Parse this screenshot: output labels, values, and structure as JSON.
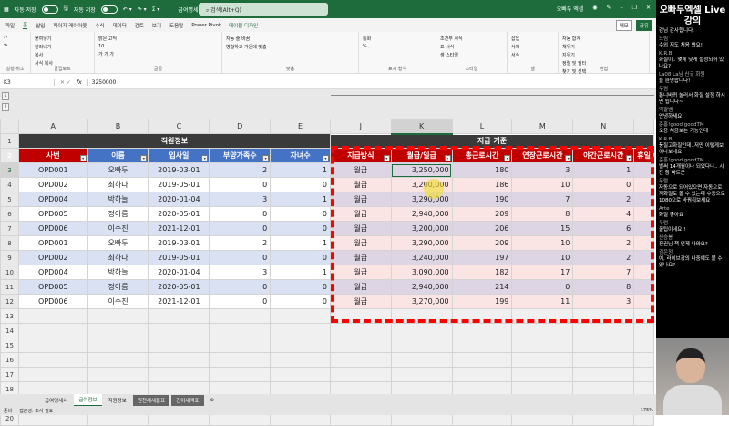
{
  "titlebar": {
    "autosave1": "자동 저장",
    "autosave2": "자동 저장",
    "filename": "급여명세서-예제파일 ▾",
    "search_placeholder": "검색(Alt+Q)",
    "user": "오빠두 엑셀"
  },
  "menu": {
    "items": [
      "파일",
      "홈",
      "삽입",
      "페이지 레이아웃",
      "수식",
      "데이터",
      "검토",
      "보기",
      "도움말",
      "Power Pivot",
      "테이블 디자인"
    ],
    "memo": "메모",
    "share": "공유"
  },
  "ribbon": {
    "groups": [
      {
        "label": "실행 취소",
        "items": [
          "↶",
          "↷"
        ]
      },
      {
        "label": "클립보드",
        "items": [
          "붙여넣기",
          "잘라내기",
          "복사",
          "서식 복사"
        ]
      },
      {
        "label": "글꼴",
        "items": [
          "맑은 고딕",
          "10",
          "가 가 가"
        ]
      },
      {
        "label": "맞춤",
        "items": [
          "자동 줄 바꿈",
          "병합하고 가운데 맞춤"
        ]
      },
      {
        "label": "표시 형식",
        "items": [
          "통화",
          "% ,"
        ]
      },
      {
        "label": "스타일",
        "items": [
          "조건부 서식",
          "표 서식",
          "셀 스타일"
        ]
      },
      {
        "label": "셀",
        "items": [
          "삽입",
          "삭제",
          "서식"
        ]
      },
      {
        "label": "편집",
        "items": [
          "자동 합계",
          "채우기",
          "지우기",
          "정렬 및 필터",
          "찾기 및 선택"
        ]
      }
    ]
  },
  "formula": {
    "namebox": "K3",
    "fx": "fx",
    "value": "3250000"
  },
  "outline": {
    "levels": [
      "1",
      "2"
    ]
  },
  "columns": [
    "A",
    "B",
    "C",
    "D",
    "E",
    "J",
    "K",
    "L",
    "M",
    "N",
    ""
  ],
  "row_numbers": [
    "1",
    "2",
    "3",
    "4",
    "5",
    "6",
    "7",
    "8",
    "9",
    "10",
    "11",
    "12",
    "13",
    "14",
    "15",
    "16",
    "17",
    "18",
    "19",
    "20"
  ],
  "band": {
    "left": "직원정보",
    "right": "지급 기준"
  },
  "headers": [
    "사번",
    "이름",
    "입사일",
    "부양가족수",
    "자녀수",
    "지급방식",
    "월급/일급",
    "총근로시간",
    "연장근로시간",
    "야간근로시간",
    "휴일"
  ],
  "rows": [
    [
      "OPD001",
      "오빠두",
      "2019-03-01",
      "2",
      "1",
      "월급",
      "3,250,000",
      "180",
      "3",
      "1"
    ],
    [
      "OPD002",
      "최하나",
      "2019-05-01",
      "0",
      "0",
      "월급",
      "3,200,000",
      "186",
      "10",
      "0"
    ],
    [
      "OPD004",
      "박하늘",
      "2020-01-04",
      "3",
      "1",
      "월급",
      "3,290,000",
      "190",
      "7",
      "2"
    ],
    [
      "OPD005",
      "정아름",
      "2020-05-01",
      "0",
      "0",
      "월급",
      "2,940,000",
      "209",
      "8",
      "4"
    ],
    [
      "OPD006",
      "이수진",
      "2021-12-01",
      "0",
      "0",
      "월급",
      "3,200,000",
      "206",
      "15",
      "6"
    ],
    [
      "OPD001",
      "오빠두",
      "2019-03-01",
      "2",
      "1",
      "월급",
      "3,290,000",
      "209",
      "10",
      "2"
    ],
    [
      "OPD002",
      "최하나",
      "2019-05-01",
      "0",
      "0",
      "월급",
      "3,240,000",
      "197",
      "10",
      "2"
    ],
    [
      "OPD004",
      "박하늘",
      "2020-01-04",
      "3",
      "1",
      "월급",
      "3,090,000",
      "182",
      "17",
      "7"
    ],
    [
      "OPD005",
      "정아름",
      "2020-05-01",
      "0",
      "0",
      "월급",
      "2,940,000",
      "214",
      "0",
      "8"
    ],
    [
      "OPD006",
      "이수진",
      "2021-12-01",
      "0",
      "0",
      "월급",
      "3,270,000",
      "199",
      "11",
      "3"
    ]
  ],
  "sheets": [
    "급여명세서",
    "급여정보",
    "직원정보",
    "원천세세율표",
    "간이세액표"
  ],
  "active_sheet": "급여정보",
  "status": {
    "ready": "준비",
    "accessibility": "접근성: 조사 필요",
    "zoom": "175%"
  },
  "chat": {
    "title": "오빠두엑셀 Live 강의",
    "messages": [
      {
        "user": "",
        "text": "감님 감사합니다."
      },
      {
        "user": "드림",
        "text": "수외 저도 처음 봐요!"
      },
      {
        "user": "K.R.B",
        "text": "화질이.. 몇레 낮게 설정되어 있나요?"
      },
      {
        "user": "La08 La님 신규 회원",
        "text": "을 환영합니다!"
      },
      {
        "user": "두럼",
        "text": "톱니바퀴 눌러서 화질 설정 하시면 됩니다~"
      },
      {
        "user": "떡팔뱀",
        "text": "안녕하세요"
      },
      {
        "user": "준홍!good goodTM",
        "text": "오옹 처음보는 기능인데"
      },
      {
        "user": "K.R.B",
        "text": "풍질고화질인데..저만 이렇게보이나보네요"
      },
      {
        "user": "준홍!good goodTM",
        "text": "벌써 14개월이나 되었다니.. 시간 참 빠르군"
      },
      {
        "user": "두럼",
        "text": "자동으로 되어있으면 자동으로 저화질로 볼 수 있는데 수동으로 1080으로 바꿔줘보세요"
      },
      {
        "user": "Arte",
        "text": "화질 좋아요"
      },
      {
        "user": "두럼",
        "text": "꿀팁이네요!!"
      },
      {
        "user": "신승봉",
        "text": "전권님 책 언제 나와요?"
      },
      {
        "user": "김은정",
        "text": "예, 라이브강의 나중에도 볼 수있나요?"
      }
    ]
  }
}
